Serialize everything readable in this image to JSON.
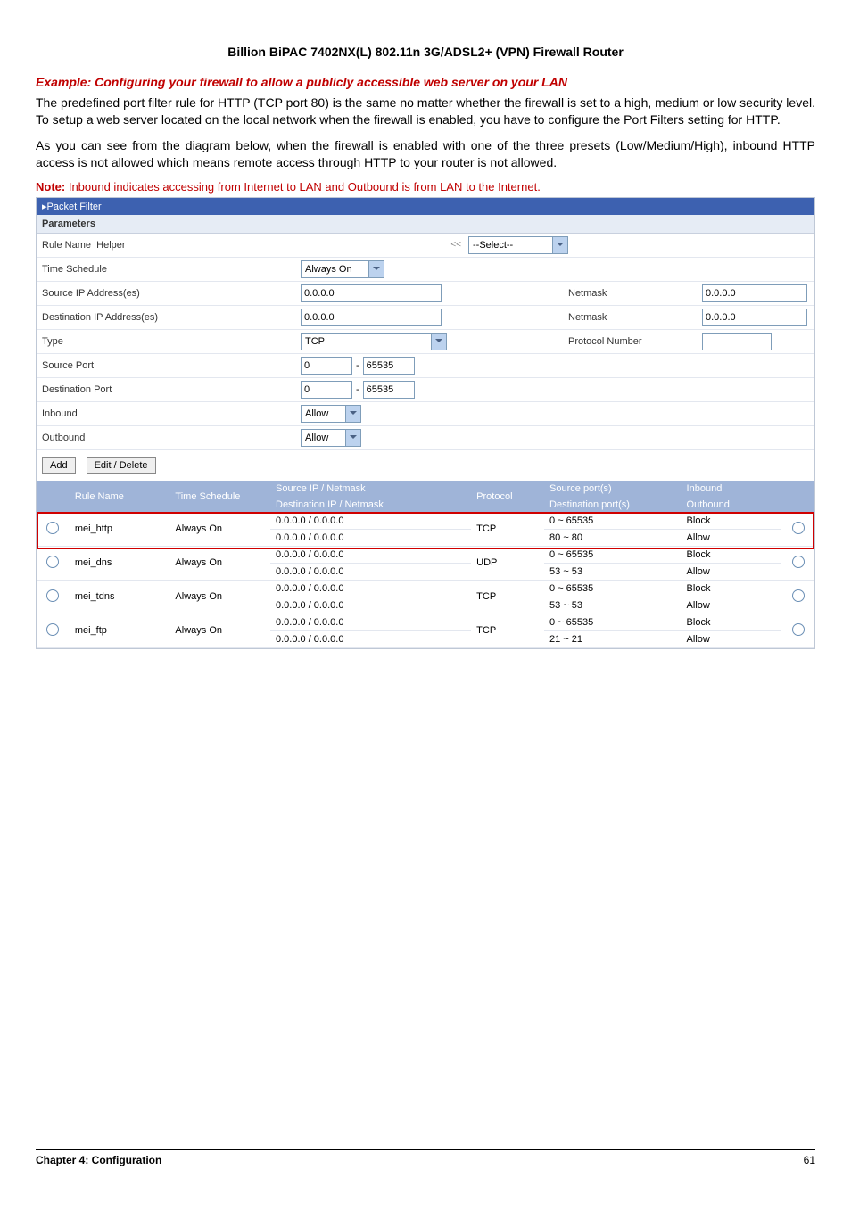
{
  "header": "Billion BiPAC 7402NX(L) 802.11n 3G/ADSL2+ (VPN) Firewall Router",
  "exampleTitle": "Example: Configuring your firewall to allow a publicly accessible web server on your LAN",
  "para1": "The predefined port filter rule for HTTP (TCP port 80) is the same no matter whether the firewall is set to a high, medium or low security level. To setup a web server located on the local network when the firewall is enabled, you have to configure the Port Filters setting for HTTP.",
  "para2": "As you can see from the diagram below, when the firewall is enabled with one of the three presets (Low/Medium/High), inbound HTTP access is not allowed which means remote access through HTTP to your router is not allowed.",
  "noteLabel": "Note:",
  "noteText": " Inbound indicates accessing from Internet to LAN and Outbound is from LAN to the Internet.",
  "panel": {
    "title": "Packet Filter",
    "sectionTitle": "Parameters",
    "rows": {
      "ruleNameLabel": "Rule Name",
      "ruleNameValue": "Helper",
      "ruleNameSelect": "--Select--",
      "timeScheduleLabel": "Time Schedule",
      "timeScheduleValue": "Always On",
      "srcIpLabel": "Source IP Address(es)",
      "srcIpValue": "0.0.0.0",
      "srcNetmaskLabel": "Netmask",
      "srcNetmaskValue": "0.0.0.0",
      "dstIpLabel": "Destination IP Address(es)",
      "dstIpValue": "0.0.0.0",
      "dstNetmaskLabel": "Netmask",
      "dstNetmaskValue": "0.0.0.0",
      "typeLabel": "Type",
      "typeValue": "TCP",
      "protoNumLabel": "Protocol Number",
      "protoNumValue": "",
      "srcPortLabel": "Source Port",
      "srcPortFrom": "0",
      "srcPortTo": "65535",
      "dstPortLabel": "Destination Port",
      "dstPortFrom": "0",
      "dstPortTo": "65535",
      "inboundLabel": "Inbound",
      "inboundValue": "Allow",
      "outboundLabel": "Outbound",
      "outboundValue": "Allow"
    },
    "buttons": {
      "add": "Add",
      "editDelete": "Edit / Delete"
    },
    "columns": {
      "ruleName": "Rule Name",
      "timeSchedule": "Time Schedule",
      "srcIp": "Source IP / Netmask",
      "dstIp": "Destination IP / Netmask",
      "protocol": "Protocol",
      "srcPorts": "Source port(s)",
      "dstPorts": "Destination port(s)",
      "inbound": "Inbound",
      "outbound": "Outbound"
    },
    "rules": [
      {
        "name": "mei_http",
        "schedule": "Always On",
        "src": "0.0.0.0 / 0.0.0.0",
        "dst": "0.0.0.0 / 0.0.0.0",
        "proto": "TCP",
        "sp": "0 ~ 65535",
        "dp": "80 ~ 80",
        "in": "Block",
        "out": "Allow",
        "highlight": true
      },
      {
        "name": "mei_dns",
        "schedule": "Always On",
        "src": "0.0.0.0 / 0.0.0.0",
        "dst": "0.0.0.0 / 0.0.0.0",
        "proto": "UDP",
        "sp": "0 ~ 65535",
        "dp": "53 ~ 53",
        "in": "Block",
        "out": "Allow",
        "highlight": false
      },
      {
        "name": "mei_tdns",
        "schedule": "Always On",
        "src": "0.0.0.0 / 0.0.0.0",
        "dst": "0.0.0.0 / 0.0.0.0",
        "proto": "TCP",
        "sp": "0 ~ 65535",
        "dp": "53 ~ 53",
        "in": "Block",
        "out": "Allow",
        "highlight": false
      },
      {
        "name": "mei_ftp",
        "schedule": "Always On",
        "src": "0.0.0.0 / 0.0.0.0",
        "dst": "0.0.0.0 / 0.0.0.0",
        "proto": "TCP",
        "sp": "0 ~ 65535",
        "dp": "21 ~ 21",
        "in": "Block",
        "out": "Allow",
        "highlight": false
      }
    ]
  },
  "footer": {
    "chapter": "Chapter 4: Configuration",
    "page": "61"
  }
}
